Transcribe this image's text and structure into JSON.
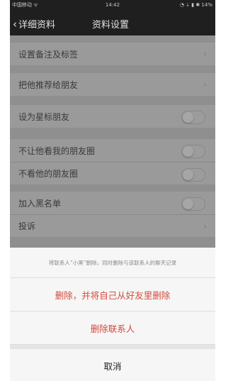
{
  "status_bar": {
    "carrier": "中国移动 ᯤ",
    "time": "14:42",
    "indicators": "◔ ⇣ ▮ ✱ 14%"
  },
  "nav": {
    "back_label": "详细资料",
    "title": "资料设置"
  },
  "settings": {
    "remark": "设置备注及标签",
    "recommend": "把他推荐给朋友",
    "star": "设为星标朋友",
    "hide_moments": "不让他看我的朋友圈",
    "no_view_moments": "不看他的朋友圈",
    "blacklist": "加入黑名单",
    "complain": "投诉",
    "toggles": {
      "star": false,
      "hide_moments": false,
      "no_view_moments": false,
      "blacklist": false
    }
  },
  "sheet": {
    "message": "将联系人“小黑”删除，同时删除与该联系人的聊天记录",
    "delete_both": "删除，并将自己从好友里删除",
    "delete_contact": "删除联系人",
    "cancel": "取消",
    "danger_color": "#d24b3a"
  }
}
